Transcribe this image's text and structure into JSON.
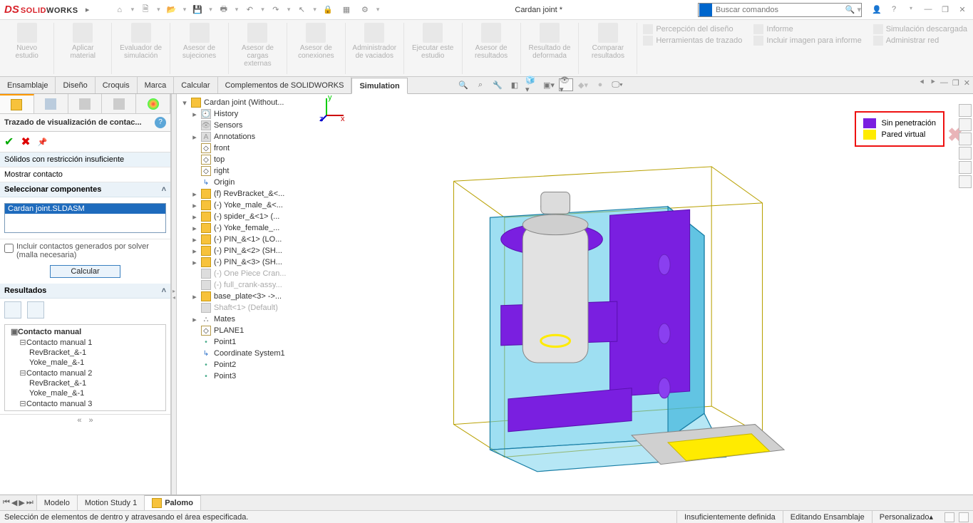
{
  "title": "Cardan joint *",
  "search_placeholder": "Buscar comandos",
  "logo": {
    "ds": "DS",
    "sw1": "SOLID",
    "sw2": "WORKS"
  },
  "ribbon": {
    "groups": [
      {
        "label": "Nuevo estudio"
      },
      {
        "label": "Aplicar material"
      },
      {
        "label": "Evaluador de simulación"
      },
      {
        "label": "Asesor de sujeciones"
      },
      {
        "label": "Asesor de cargas externas"
      },
      {
        "label": "Asesor de conexiones"
      },
      {
        "label": "Administrador de vaciados"
      },
      {
        "label": "Ejecutar este estudio"
      },
      {
        "label": "Asesor de resultados"
      },
      {
        "label": "Resultado de deformada"
      },
      {
        "label": "Comparar resultados"
      }
    ],
    "right_rows": [
      "Percepción del diseño",
      "Herramientas de trazado",
      "Informe",
      "Incluir imagen para informe",
      "Simulación descargada",
      "Administrar red"
    ]
  },
  "tabs": [
    "Ensamblaje",
    "Diseño",
    "Croquis",
    "Marca",
    "Calcular",
    "Complementos de SOLIDWORKS",
    "Simulation"
  ],
  "active_tab": "Simulation",
  "pm": {
    "title": "Trazado de visualización de contac...",
    "sec1": "Sólidos con restricción insuficiente",
    "sec2": "Mostrar contacto",
    "sec_sel": "Seleccionar componentes",
    "sel_item": "Cardan joint.SLDASM",
    "chk": "Incluir contactos generados por solver (malla necesaria)",
    "btn_calc": "Calcular",
    "sec_res": "Resultados",
    "res_root": "Contacto manual",
    "res_items": [
      "Contacto manual 1",
      "RevBracket_&-1",
      "Yoke_male_&-1",
      "Contacto manual 2",
      "RevBracket_&-1",
      "Yoke_male_&-1",
      "Contacto manual 3"
    ]
  },
  "ftree": {
    "root": "Cardan joint  (Without...",
    "items": [
      {
        "t": "History",
        "k": "hist"
      },
      {
        "t": "Sensors",
        "k": "sens"
      },
      {
        "t": "Annotations",
        "k": "ann"
      },
      {
        "t": "front",
        "k": "plane"
      },
      {
        "t": "top",
        "k": "plane"
      },
      {
        "t": "right",
        "k": "plane"
      },
      {
        "t": "Origin",
        "k": "origin"
      },
      {
        "t": "(f) RevBracket_&<...",
        "k": "part"
      },
      {
        "t": "(-) Yoke_male_&<...",
        "k": "part"
      },
      {
        "t": "(-) spider_&<1> (...",
        "k": "part"
      },
      {
        "t": "(-) Yoke_female_...",
        "k": "part"
      },
      {
        "t": "(-) PIN_&<1> (LO...",
        "k": "part"
      },
      {
        "t": "(-) PIN_&<2> (SH...",
        "k": "part"
      },
      {
        "t": "(-) PIN_&<3> (SH...",
        "k": "part"
      },
      {
        "t": "(-) One Piece Cran...",
        "k": "grey"
      },
      {
        "t": "(-) full_crank-assy...",
        "k": "grey"
      },
      {
        "t": "base_plate<3> ->...",
        "k": "part"
      },
      {
        "t": "Shaft<1> (Default)",
        "k": "grey"
      },
      {
        "t": "Mates",
        "k": "mate"
      },
      {
        "t": "PLANE1",
        "k": "plane"
      },
      {
        "t": "Point1",
        "k": "pt"
      },
      {
        "t": "Coordinate System1",
        "k": "origin"
      },
      {
        "t": "Point2",
        "k": "pt"
      },
      {
        "t": "Point3",
        "k": "pt"
      }
    ]
  },
  "legend": [
    {
      "color": "#7a1fe0",
      "label": "Sin penetración"
    },
    {
      "color": "#ffeb00",
      "label": "Pared virtual"
    }
  ],
  "bottom_tabs": {
    "model": "Modelo",
    "motion": "Motion Study 1",
    "palomo": "Palomo"
  },
  "status": {
    "left": "Selección de elementos de dentro y atravesando el área especificada.",
    "mid": "Insuficientemente definida",
    "right": "Editando Ensamblaje",
    "custom": "Personalizado"
  }
}
